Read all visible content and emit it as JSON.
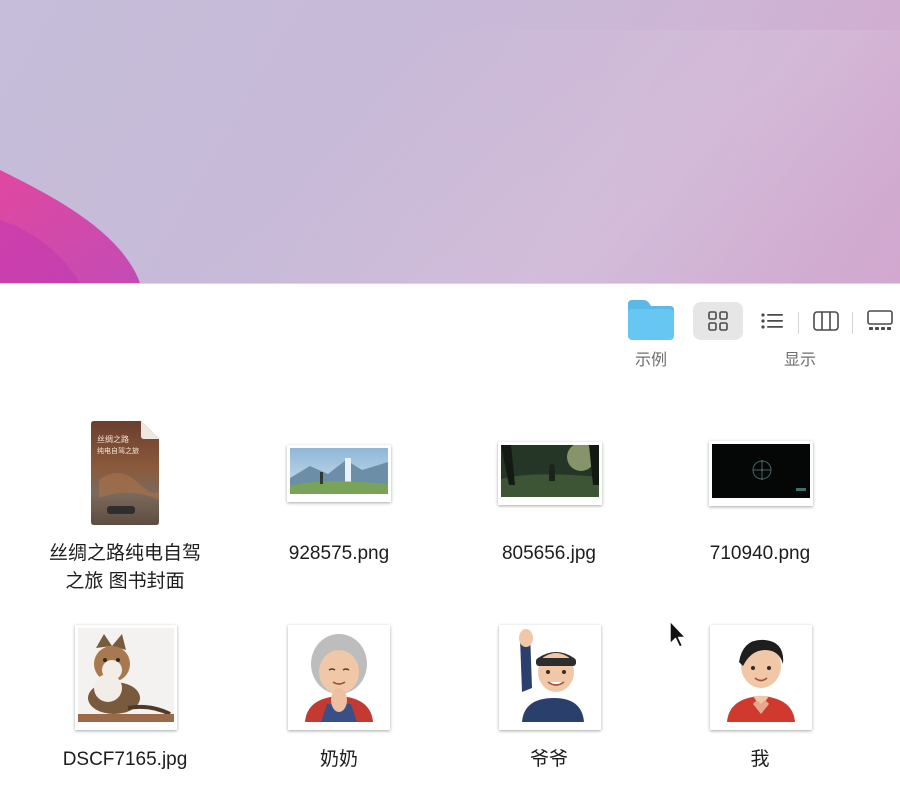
{
  "toolbar": {
    "folder_label": "示例",
    "view_label": "显示",
    "folder_icon": "folder-icon",
    "view_icons": [
      "grid-view-icon",
      "list-view-icon",
      "column-view-icon",
      "gallery-view-icon"
    ]
  },
  "files": [
    {
      "name": "丝绸之路纯电自驾",
      "name2": "之旅 图书封面",
      "icon": "document-thumbnail",
      "cover_text": [
        "丝绸之路",
        "纯电自驾之旅"
      ]
    },
    {
      "name": "928575.png",
      "icon": "image-thumbnail"
    },
    {
      "name": "805656.jpg",
      "icon": "image-thumbnail"
    },
    {
      "name": "710940.png",
      "icon": "image-thumbnail"
    },
    {
      "name": "DSCF7165.jpg",
      "icon": "image-thumbnail"
    },
    {
      "name": "奶奶",
      "icon": "memoji-thumbnail"
    },
    {
      "name": "爷爷",
      "icon": "memoji-thumbnail"
    },
    {
      "name": "我",
      "icon": "memoji-thumbnail"
    }
  ],
  "colors": {
    "folder_blue": "#67c6f2",
    "selected_view_bg": "#e6e6e6",
    "label_text": "#1d1d1d",
    "toolbar_text": "#6e6e6e"
  }
}
